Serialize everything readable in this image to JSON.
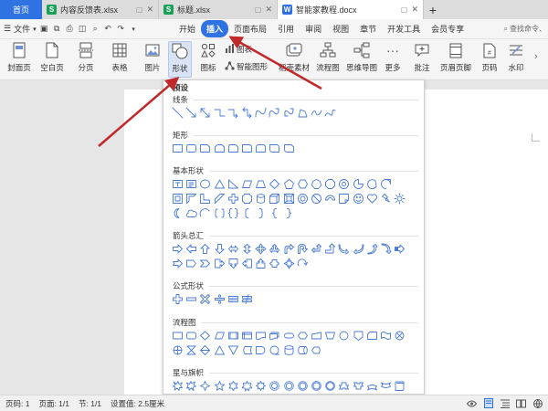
{
  "titlebar": {
    "home": "首页",
    "tabs": [
      {
        "label": "内容反馈表.xlsx",
        "type": "S"
      },
      {
        "label": "标题.xlsx",
        "type": "S"
      },
      {
        "label": "智能家教程.docx",
        "type": "W"
      }
    ],
    "add": "+"
  },
  "menubar": {
    "file": "文件",
    "items": [
      "开始",
      "插入",
      "页面布局",
      "引用",
      "审阅",
      "视图",
      "章节",
      "开发工具",
      "会员专享"
    ],
    "active_index": 1,
    "search": "查找命令、"
  },
  "ribbon": {
    "cover": "封面页",
    "blank": "空白页",
    "page_break": "分页",
    "table": "表格",
    "picture": "图片",
    "shape": "形状",
    "icon": "图标",
    "chart": "图表",
    "smart": "智能图形",
    "material": "稻壳素材",
    "flowchart": "流程图",
    "mindmap": "思维导图",
    "more": "更多",
    "comment": "批注",
    "header_footer": "页眉页脚",
    "page_number": "页码",
    "watermark": "水印"
  },
  "dropdown": {
    "preset": "预设",
    "sections": [
      {
        "title": "线条",
        "key": "lines"
      },
      {
        "title": "矩形",
        "key": "rect"
      },
      {
        "title": "基本形状",
        "key": "basic"
      },
      {
        "title": "箭头总汇",
        "key": "arrows"
      },
      {
        "title": "公式形状",
        "key": "formula"
      },
      {
        "title": "流程图",
        "key": "flow"
      },
      {
        "title": "星与旗帜",
        "key": "stars"
      }
    ]
  },
  "statusbar": {
    "page": "页码: 1",
    "pages": "页面: 1/1",
    "section": "节: 1/1",
    "setting": "设置值: 2.5厘米"
  },
  "colors": {
    "accent": "#2f73e3",
    "shape_stroke": "#4a7bd4",
    "arrow": "#c0282a"
  }
}
